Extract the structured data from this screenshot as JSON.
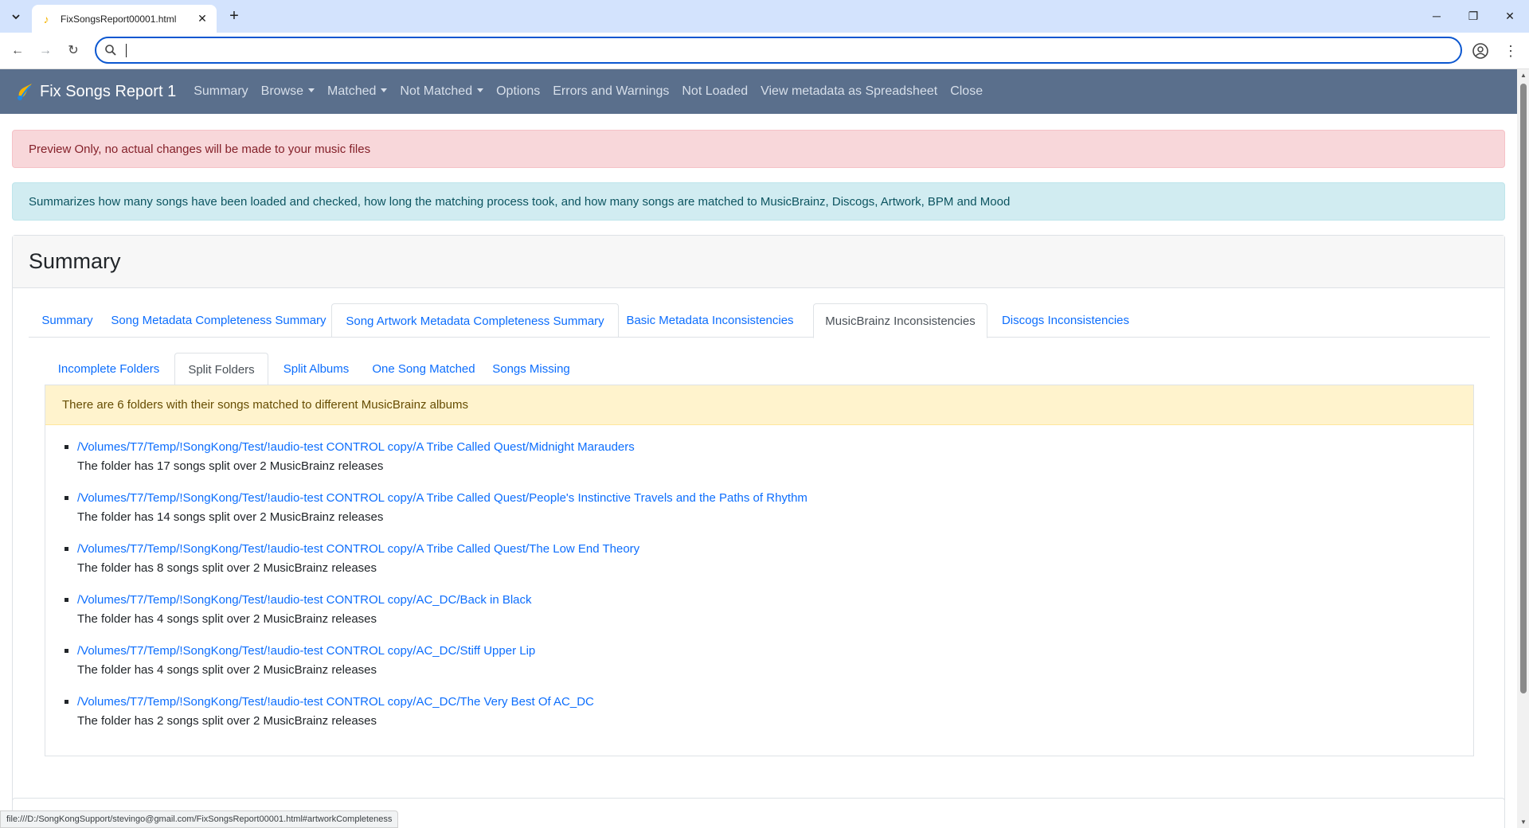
{
  "browser": {
    "tab_title": "FixSongsReport00001.html",
    "address_value": "",
    "status_url": "file:///D:/SongKongSupport/stevingo@gmail.com/FixSongsReport00001.html#artworkCompleteness"
  },
  "navbar": {
    "brand": "Fix Songs Report 1",
    "links": [
      "Summary",
      "Browse",
      "Matched",
      "Not Matched",
      "Options",
      "Errors and Warnings",
      "Not Loaded",
      "View metadata as Spreadsheet",
      "Close"
    ]
  },
  "alerts": {
    "preview": "Preview Only, no actual changes will be made to your music files",
    "info": "Summarizes how many songs have been loaded and checked, how long the matching process took, and how many songs are matched to MusicBrainz, Discogs, Artwork, BPM and Mood"
  },
  "card": {
    "title": "Summary",
    "tabs": [
      "Summary",
      "Song Metadata Completeness Summary",
      "Song Artwork Metadata Completeness Summary",
      "Basic Metadata Inconsistencies",
      "MusicBrainz Inconsistencies",
      "Discogs Inconsistencies"
    ],
    "subtabs": [
      "Incomplete Folders",
      "Split Folders",
      "Split Albums",
      "One Song Matched",
      "Songs Missing"
    ],
    "warning": "There are 6 folders with their songs matched to different MusicBrainz albums",
    "folders": [
      {
        "path": "/Volumes/T7/Temp/!SongKong/Test/!audio-test CONTROL copy/A Tribe Called Quest/Midnight Marauders",
        "desc": "The folder has 17 songs split over 2 MusicBrainz releases"
      },
      {
        "path": "/Volumes/T7/Temp/!SongKong/Test/!audio-test CONTROL copy/A Tribe Called Quest/People's Instinctive Travels and the Paths of Rhythm",
        "desc": "The folder has 14 songs split over 2 MusicBrainz releases"
      },
      {
        "path": "/Volumes/T7/Temp/!SongKong/Test/!audio-test CONTROL copy/A Tribe Called Quest/The Low End Theory",
        "desc": "The folder has 8 songs split over 2 MusicBrainz releases"
      },
      {
        "path": "/Volumes/T7/Temp/!SongKong/Test/!audio-test CONTROL copy/AC_DC/Back in Black",
        "desc": "The folder has 4 songs split over 2 MusicBrainz releases"
      },
      {
        "path": "/Volumes/T7/Temp/!SongKong/Test/!audio-test CONTROL copy/AC_DC/Stiff Upper Lip",
        "desc": "The folder has 4 songs split over 2 MusicBrainz releases"
      },
      {
        "path": "/Volumes/T7/Temp/!SongKong/Test/!audio-test CONTROL copy/AC_DC/The Very Best Of AC_DC",
        "desc": "The folder has 2 songs split over 2 MusicBrainz releases"
      }
    ]
  }
}
